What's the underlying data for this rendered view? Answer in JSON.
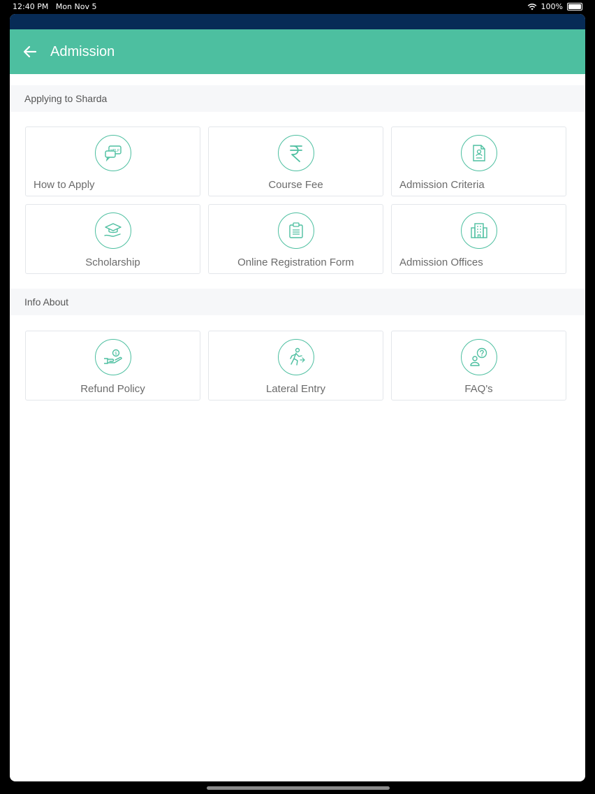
{
  "status_bar": {
    "time": "12:40 PM",
    "date": "Mon Nov 5",
    "battery": "100%"
  },
  "app_bar": {
    "title": "Admission"
  },
  "sections": [
    {
      "header": "Applying to Sharda",
      "cards": [
        {
          "label": "How to Apply",
          "icon": "help-chat-icon"
        },
        {
          "label": "Course Fee",
          "icon": "rupee-icon"
        },
        {
          "label": "Admission Criteria",
          "icon": "document-profile-icon"
        },
        {
          "label": "Scholarship",
          "icon": "graduation-cap-hand-icon"
        },
        {
          "label": "Online Registration Form",
          "icon": "registration-board-icon"
        },
        {
          "label": "Admission Offices",
          "icon": "building-icon"
        }
      ]
    },
    {
      "header": "Info About",
      "cards": [
        {
          "label": "Refund Policy",
          "icon": "money-hand-icon"
        },
        {
          "label": "Lateral Entry",
          "icon": "running-person-icon"
        },
        {
          "label": "FAQ's",
          "icon": "question-person-icon"
        }
      ]
    }
  ],
  "colors": {
    "accent": "#4dbfa0",
    "top_strip": "#072b56",
    "section_bg": "#f6f7f9"
  }
}
